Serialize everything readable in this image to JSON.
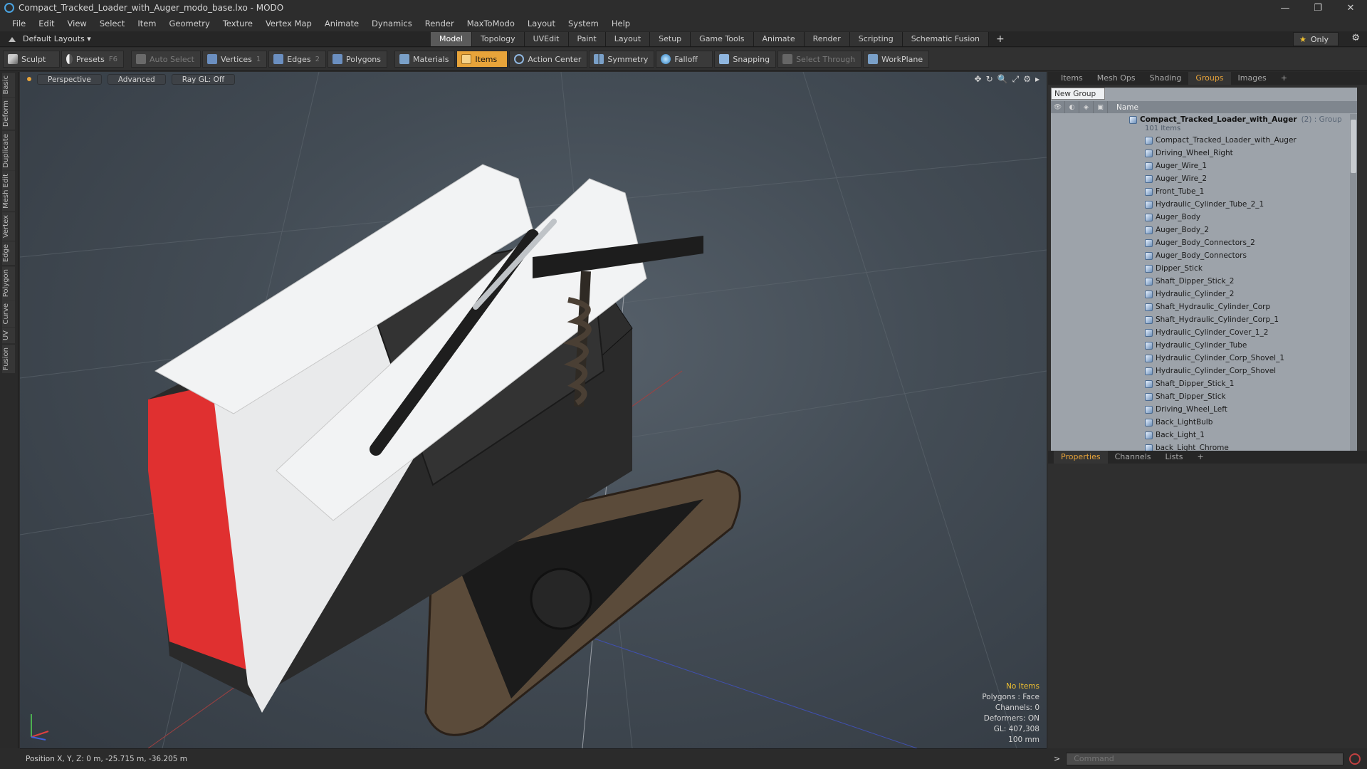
{
  "window": {
    "title": "Compact_Tracked_Loader_with_Auger_modo_base.lxo - MODO",
    "minimize": "—",
    "restore": "❐",
    "close": "✕"
  },
  "menu": [
    "File",
    "Edit",
    "View",
    "Select",
    "Item",
    "Geometry",
    "Texture",
    "Vertex Map",
    "Animate",
    "Dynamics",
    "Render",
    "MaxToModo",
    "Layout",
    "System",
    "Help"
  ],
  "layout": {
    "preset": "Default Layouts ▾",
    "tabs": [
      "Model",
      "Topology",
      "UVEdit",
      "Paint",
      "Layout",
      "Setup",
      "Game Tools",
      "Animate",
      "Render",
      "Scripting",
      "Schematic Fusion"
    ],
    "active_tab": "Model",
    "plus": "+",
    "only_star": "★",
    "only": "Only",
    "gear": "⚙"
  },
  "toolbar": {
    "sculpt": "Sculpt",
    "presets": "Presets",
    "presets_key": "F6",
    "auto_select": "Auto Select",
    "vertices": "Vertices",
    "vertices_count": "1",
    "edges": "Edges",
    "edges_count": "2",
    "polygons": "Polygons",
    "materials": "Materials",
    "items": "Items",
    "action_center": "Action Center",
    "symmetry": "Symmetry",
    "falloff": "Falloff",
    "snapping": "Snapping",
    "select_through": "Select Through",
    "workplane": "WorkPlane"
  },
  "left_tabs": [
    "Basic",
    "Deform",
    "Duplicate",
    "Mesh Edit",
    "Vertex",
    "Edge",
    "Polygon",
    "Curve",
    "UV",
    "Fusion"
  ],
  "viewport": {
    "view": "Perspective",
    "shading": "Advanced",
    "raygl": "Ray GL: Off",
    "icons": [
      "✥",
      "↻",
      "🔍",
      "⤢",
      "⚙",
      "▸"
    ],
    "info": {
      "selection": "No Items",
      "polygons": "Polygons : Face",
      "channels": "Channels: 0",
      "deformers": "Deformers: ON",
      "gl": "GL: 407,308",
      "scale": "100 mm"
    }
  },
  "status": {
    "position": "Position X, Y, Z:  0 m, -25.715 m, -36.205 m"
  },
  "items_panel": {
    "tabs": [
      "Items",
      "Mesh Ops",
      "Shading",
      "Groups",
      "Images",
      "+"
    ],
    "active_tab": "Groups",
    "new_group": "New Group",
    "name_header": "Name",
    "group": {
      "name": "Compact_Tracked_Loader_with_Auger",
      "count": "(2) : Group",
      "sub": "101 Items"
    },
    "items": [
      "Compact_Tracked_Loader_with_Auger",
      "Driving_Wheel_Right",
      "Auger_Wire_1",
      "Auger_Wire_2",
      "Front_Tube_1",
      "Hydraulic_Cylinder_Tube_2_1",
      "Auger_Body",
      "Auger_Body_2",
      "Auger_Body_Connectors_2",
      "Auger_Body_Connectors",
      "Dipper_Stick",
      "Shaft_Dipper_Stick_2",
      "Hydraulic_Cylinder_2",
      "Shaft_Hydraulic_Cylinder_Corp",
      "Shaft_Hydraulic_Cylinder_Corp_1",
      "Hydraulic_Cylinder_Cover_1_2",
      "Hydraulic_Cylinder_Tube",
      "Hydraulic_Cylinder_Corp_Shovel_1",
      "Hydraulic_Cylinder_Corp_Shovel",
      "Shaft_Dipper_Stick_1",
      "Shaft_Dipper_Stick",
      "Driving_Wheel_Left",
      "Back_LightBulb",
      "Back_Light_1",
      "back_Light_Chrome"
    ]
  },
  "props_panel": {
    "tabs": [
      "Properties",
      "Channels",
      "Lists",
      "+"
    ],
    "active_tab": "Properties"
  },
  "command": {
    "placeholder": "Command",
    "arrow": ">"
  }
}
